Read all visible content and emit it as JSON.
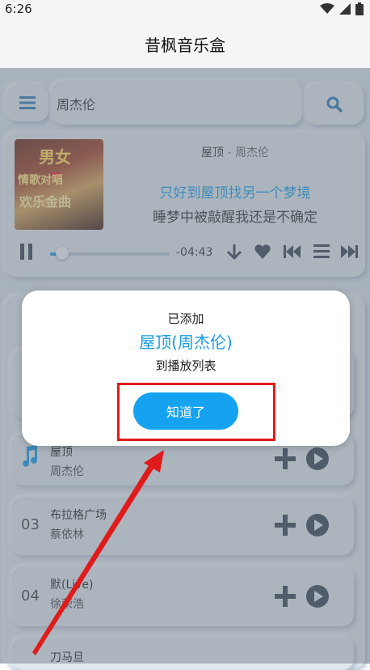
{
  "status_bar": {
    "time": "6:26"
  },
  "app": {
    "title": "昔枫音乐盒"
  },
  "search": {
    "value": "周杰伦"
  },
  "player": {
    "cover_text": [
      "男女",
      "情歌对唱",
      "欢乐金曲"
    ],
    "song": "屋顶",
    "separator": " - ",
    "artist": "周杰伦",
    "lyric_current": "只好到屋顶找另一个梦境",
    "lyric_next": "睡梦中被敲醒我还是不确定",
    "remaining_time": "-04:43",
    "progress_fraction": 0.1
  },
  "songs": [
    {
      "num": "",
      "name": "屋顶",
      "artist": "周杰伦",
      "playing": true
    },
    {
      "num": "03",
      "name": "布拉格广场",
      "artist": "蔡依林",
      "playing": false
    },
    {
      "num": "04",
      "name": "默(Live)",
      "artist": "徐荣浩",
      "playing": false
    },
    {
      "num": "",
      "name": "刀马旦",
      "artist": "",
      "playing": false
    }
  ],
  "dialog": {
    "line1": "已添加",
    "line2": "屋顶(周杰伦)",
    "line3": "到播放列表",
    "confirm": "知道了"
  },
  "colors": {
    "accent": "#1a9be3",
    "button": "#15a3f1",
    "annotation": "#e01b1b",
    "background": "#d8e2ec"
  },
  "icons": [
    "wifi-icon",
    "signal-icon",
    "battery-icon",
    "menu-icon",
    "search-icon",
    "pause-icon",
    "download-icon",
    "heart-icon",
    "previous-icon",
    "playlist-icon",
    "next-icon",
    "music-note-icon",
    "add-icon",
    "play-icon"
  ]
}
